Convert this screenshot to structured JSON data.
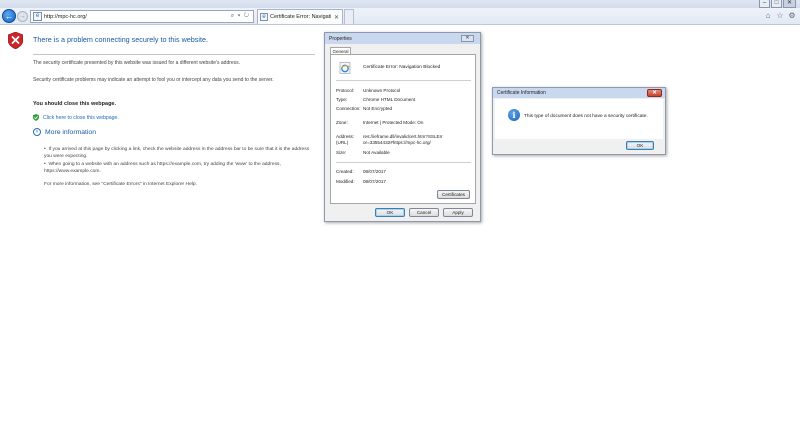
{
  "browser": {
    "address_url": "http://mpc-hc.org/",
    "address_tools": "⌕ ▾ ↻",
    "tab_label": "Certificate Error: Navigatio...",
    "tab_close": "✕",
    "window_controls": [
      "–",
      "□",
      "✕"
    ],
    "toolbar_icons": [
      "home-icon",
      "favorites-star-icon",
      "settings-gear-icon"
    ]
  },
  "error_page": {
    "title": "There is a problem connecting securely to this website.",
    "paragraph1": "The security certificate presented by this website was issued for a different website's address.",
    "paragraph2": "Security certificate problems may indicate an attempt to fool you or intercept any data you send to the server.",
    "close_heading": "You should close this webpage.",
    "close_link": "Click here to close this webpage.",
    "more_info": "More information",
    "bullet1": "If you arrived at this page by clicking a link, check the website address in the address bar to be sure that it is the address you were expecting.",
    "bullet2": "When going to a website with an address such as https://example.com, try adding the 'www' to the address, https://www.example.com.",
    "more_help": "For more information, see \"Certificate Errors\" in Internet Explorer Help."
  },
  "properties_dialog": {
    "title": "Properties",
    "tab": "General",
    "name": "Certificate Error: Navigation Blocked",
    "rows": [
      {
        "label": "Protocol:",
        "value": "Unknown Protocol"
      },
      {
        "label": "Type:",
        "value": "Chrome HTML Document"
      },
      {
        "label": "Connection:",
        "value": "Not Encrypted"
      },
      {
        "label": "Zone:",
        "value": "Internet | Protected Mode: On"
      },
      {
        "label": "Address:\n(URL)",
        "value": "res://ieframe.dll/invalidcert.htm?SSLError=33554432#https://mpc-hc.org/"
      },
      {
        "label": "Size:",
        "value": "Not Available"
      },
      {
        "label": "Created:",
        "value": "08/07/2017"
      },
      {
        "label": "Modified:",
        "value": "08/07/2017"
      }
    ],
    "certificates_button": "Certificates",
    "ok_button": "OK",
    "cancel_button": "Cancel",
    "apply_button": "Apply"
  },
  "certificate_dialog": {
    "title": "Certificate Information",
    "message": "This type of document does not have a security certificate.",
    "ok_button": "OK"
  },
  "colors": {
    "title_blue": "#1a5aa6",
    "link_blue": "#1f6bbf",
    "error_red": "#c8262b"
  }
}
